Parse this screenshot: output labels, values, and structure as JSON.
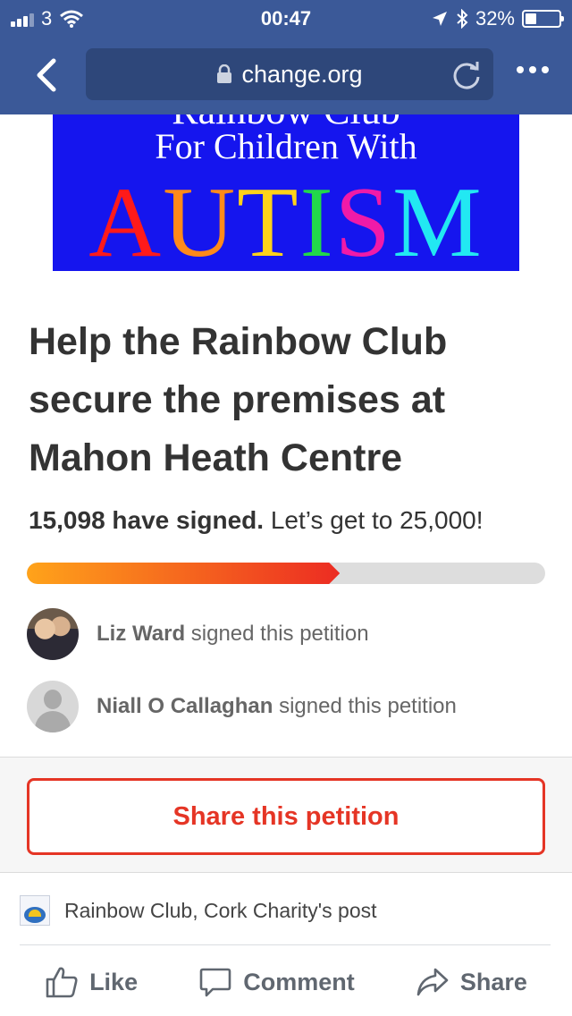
{
  "status_bar": {
    "carrier": "3",
    "time": "00:47",
    "battery_percent": "32%",
    "battery_level": 0.32,
    "icons": [
      "signal-icon",
      "wifi-icon",
      "location-arrow-icon",
      "bluetooth-icon",
      "battery-icon"
    ]
  },
  "browser": {
    "url": "change.org",
    "icons": [
      "back-icon",
      "lock-icon",
      "reload-icon",
      "more-icon"
    ]
  },
  "banner": {
    "partial_line": "Rainbow Club",
    "subtitle": "For Children With",
    "headline": "AUTISM",
    "headline_letters": [
      "A",
      "U",
      "T",
      "I",
      "S",
      "M"
    ],
    "colors": {
      "background": "#1515ee",
      "letters": [
        "#ff1a1a",
        "#ff8a1a",
        "#ffd21a",
        "#22d84a",
        "#f01aa8",
        "#22e8f2"
      ]
    }
  },
  "petition": {
    "title": "Help the Rainbow Club secure the premises at Mahon Heath Centre",
    "signed_count_text": "15,098 have signed.",
    "goal_text": "Let’s get to 25,000!",
    "signed": 15098,
    "goal": 25000,
    "progress_fraction": 0.6039
  },
  "signers": [
    {
      "name": "Liz Ward",
      "action": "signed this petition",
      "avatar": "photo"
    },
    {
      "name": "Niall O Callaghan",
      "action": "signed this petition",
      "avatar": "placeholder"
    }
  ],
  "share_button_label": "Share this petition",
  "post": {
    "label": "Rainbow Club, Cork Charity's post"
  },
  "actions": {
    "like": "Like",
    "comment": "Comment",
    "share": "Share"
  },
  "colors": {
    "facebook_blue": "#3b5998",
    "url_box": "#2e477a",
    "accent_red": "#e53525",
    "progress_start": "#ffa31a",
    "progress_end": "#ec2c22"
  }
}
